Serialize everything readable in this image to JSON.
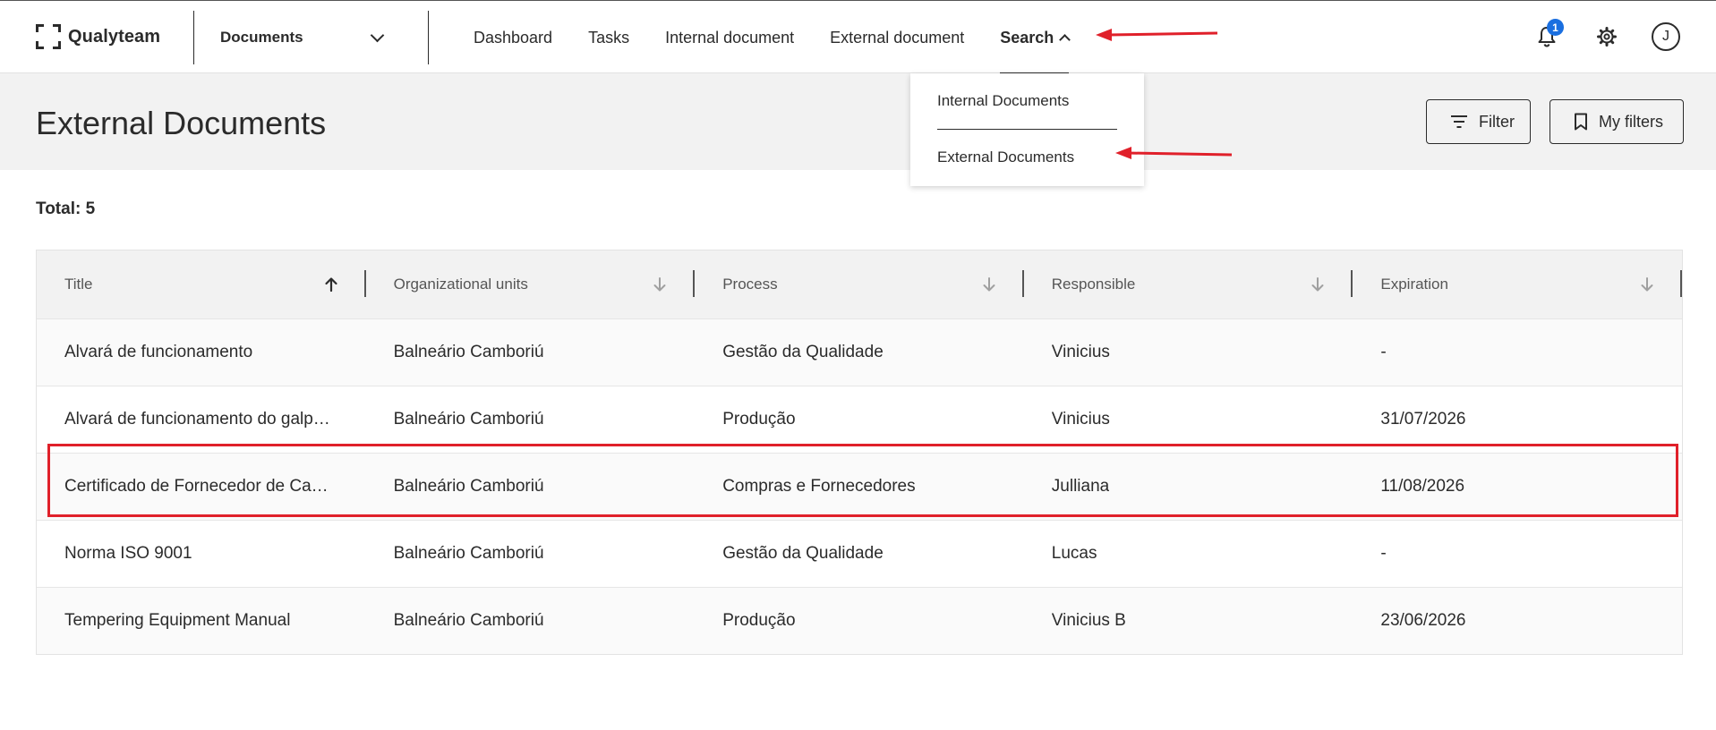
{
  "app": {
    "brand": "Qualyteam",
    "module": "Documents"
  },
  "nav": {
    "items": [
      {
        "label": "Dashboard"
      },
      {
        "label": "Tasks"
      },
      {
        "label": "Internal document"
      },
      {
        "label": "External document"
      },
      {
        "label": "Search"
      }
    ],
    "notifications_count": "1",
    "user_initial": "J"
  },
  "search_menu": {
    "items": [
      {
        "label": "Internal Documents"
      },
      {
        "label": "External Documents"
      }
    ]
  },
  "page": {
    "title": "External Documents",
    "filter_label": "Filter",
    "my_filters_label": "My filters",
    "total": "Total: 5"
  },
  "table": {
    "columns": [
      {
        "label": "Title",
        "sort": "ascending"
      },
      {
        "label": "Organizational units",
        "sort": "none"
      },
      {
        "label": "Process",
        "sort": "none"
      },
      {
        "label": "Responsible",
        "sort": "none"
      },
      {
        "label": "Expiration",
        "sort": "none"
      }
    ],
    "rows": [
      [
        "Alvará de funcionamento",
        "Balneário Camboriú",
        "Gestão da Qualidade",
        "Vinicius",
        "-"
      ],
      [
        "Alvará de funcionamento do galp…",
        "Balneário Camboriú",
        "Produção",
        "Vinicius",
        "31/07/2026"
      ],
      [
        "Certificado de Fornecedor de Ca…",
        "Balneário Camboriú",
        "Compras e Fornecedores",
        "Julliana",
        "11/08/2026"
      ],
      [
        "Norma ISO 9001",
        "Balneário Camboriú",
        "Gestão da Qualidade",
        "Lucas",
        "-"
      ],
      [
        "Tempering Equipment Manual",
        "Balneário Camboriú",
        "Produção",
        "Vinicius B",
        "23/06/2026"
      ]
    ]
  },
  "colors": {
    "text": "#2b2b2b",
    "header_band": "#f2f2f2",
    "badge": "#1a6fe0",
    "annotation": "#e0202a"
  },
  "icons": [
    "qualyteam-logo-icon",
    "chevron-down-icon",
    "chevron-up-icon",
    "bell-icon",
    "gear-icon",
    "filter-icon",
    "bookmark-icon",
    "arrow-up-icon",
    "arrow-down-icon"
  ]
}
